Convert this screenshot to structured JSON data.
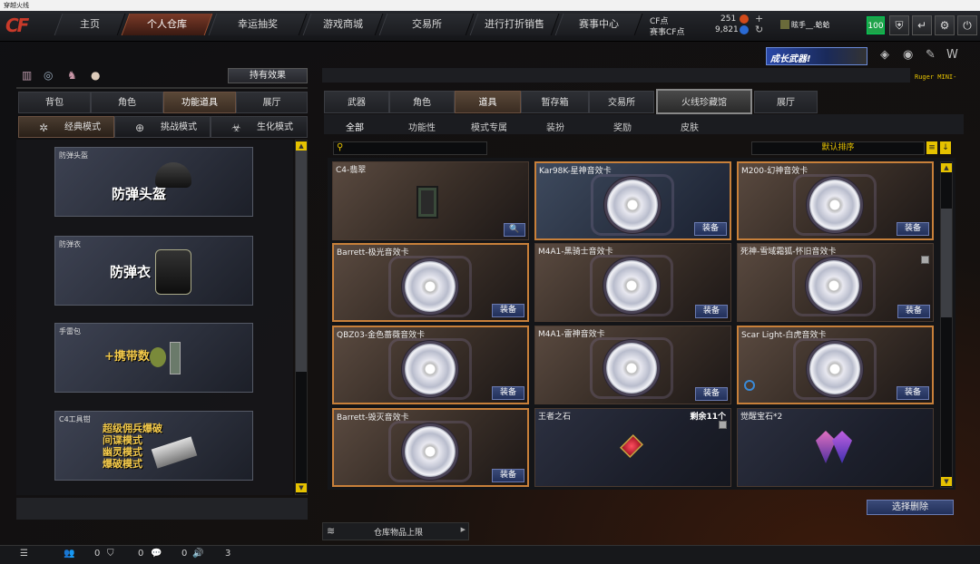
{
  "window": {
    "title": "穿越火线"
  },
  "logo": "CF",
  "nav": [
    "主页",
    "个人仓库",
    "幸运抽奖",
    "游戏商城",
    "交易所",
    "进行打折销售",
    "赛事中心"
  ],
  "currency": {
    "cf_label": "CF点",
    "cf_value": "251",
    "event_label": "赛事CF点",
    "event_value": "9,821"
  },
  "user": {
    "name": "眩手__.蛤蛤",
    "level": "100"
  },
  "banner": {
    "text": "成长武器!"
  },
  "weapon_label": "Ruger MINI-",
  "left": {
    "effect_button": "持有效果",
    "tabs": [
      "背包",
      "角色",
      "功能道具",
      "展厅"
    ],
    "modes": [
      "经典模式",
      "挑战模式",
      "生化模式"
    ],
    "cards": [
      {
        "tag": "防弹头盔",
        "title": "防弹头盔"
      },
      {
        "tag": "防弹衣",
        "title": "防弹衣"
      },
      {
        "tag": "手雷包",
        "title": "+携带数"
      },
      {
        "tag": "C4工具钳",
        "lines": [
          "超级佣兵爆破",
          "间谍模式",
          "幽灵模式",
          "爆破模式"
        ]
      }
    ]
  },
  "right": {
    "tabs": [
      "武器",
      "角色",
      "道具",
      "暂存箱",
      "交易所",
      "火线珍藏馆",
      "展厅"
    ],
    "filters": [
      "全部",
      "功能性",
      "模式专属",
      "装扮",
      "奖励",
      "皮肤"
    ],
    "sort": "默认排序",
    "items": [
      {
        "name": "C4-翡翠",
        "button": "🔍"
      },
      {
        "name": "Kar98K-星神音效卡",
        "button": "装备"
      },
      {
        "name": "M200-幻神音效卡",
        "button": "装备"
      },
      {
        "name": "Barrett-极光音效卡",
        "button": "装备"
      },
      {
        "name": "M4A1-黑骑士音效卡",
        "button": "装备"
      },
      {
        "name": "死神-雪域霜狐-怀旧音效卡",
        "button": "装备"
      },
      {
        "name": "QBZ03-金色蔷薇音效卡",
        "button": "装备"
      },
      {
        "name": "M4A1-雷神音效卡",
        "button": "装备"
      },
      {
        "name": "Scar Light-白虎音效卡",
        "button": "装备"
      },
      {
        "name": "Barrett-毁灭音效卡",
        "button": "装备"
      },
      {
        "name": "王者之石",
        "count": "剩余11个"
      },
      {
        "name": "觉醒宝石*2"
      }
    ],
    "delete_button": "选择删除",
    "storage_limit": "仓库物品上限"
  },
  "bottom": {
    "values": [
      "0",
      "0",
      "0",
      "3"
    ]
  }
}
